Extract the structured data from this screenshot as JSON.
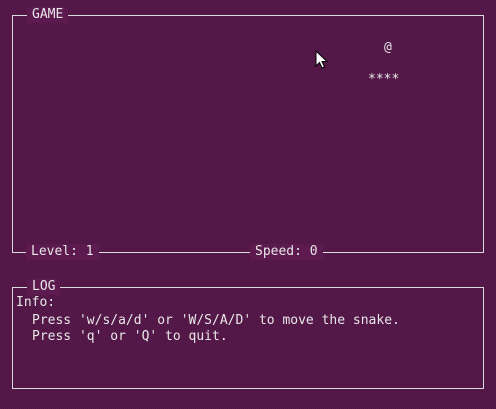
{
  "game_panel": {
    "title": "GAME",
    "level_label": "Level: 1",
    "speed_label": "Speed: 0",
    "snake_head": "@",
    "snake_body": "****"
  },
  "log_panel": {
    "title": "LOG",
    "lines": [
      "Info:",
      "Press 'w/s/a/d' or 'W/S/A/D' to move the snake.",
      "Press 'q' or 'Q' to quit."
    ]
  }
}
